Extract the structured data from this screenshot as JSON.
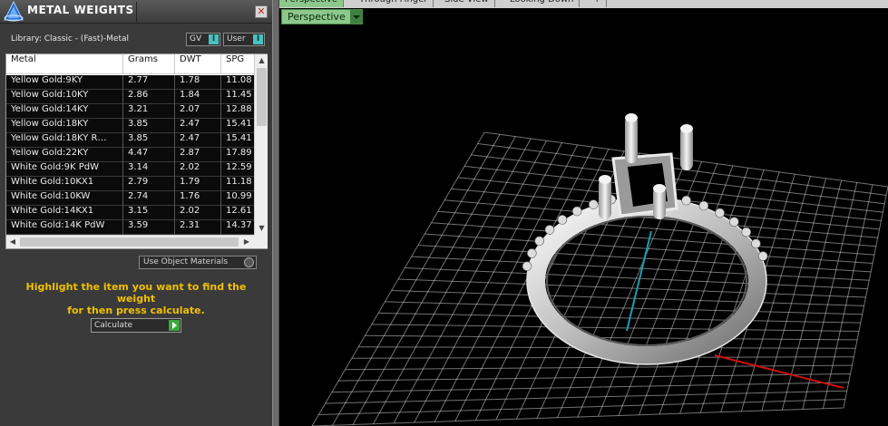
{
  "panel": {
    "title": "METAL WEIGHTS",
    "close_glyph": "✕",
    "library_label": "Library: Classic - (Fast)-Metal",
    "gv_label": "GV",
    "user_label": "User",
    "toggle_glyph": "I",
    "columns": [
      "Metal",
      "Grams",
      "DWT",
      "SPG"
    ],
    "rows": [
      {
        "metal": "Yellow Gold:9KY",
        "grams": "2.77",
        "dwt": "1.78",
        "spg": "11.08"
      },
      {
        "metal": "Yellow Gold:10KY",
        "grams": "2.86",
        "dwt": "1.84",
        "spg": "11.45"
      },
      {
        "metal": "Yellow Gold:14KY",
        "grams": "3.21",
        "dwt": "2.07",
        "spg": "12.88"
      },
      {
        "metal": "Yellow Gold:18KY",
        "grams": "3.85",
        "dwt": "2.47",
        "spg": "15.41"
      },
      {
        "metal": "Yellow Gold:18KY R…",
        "grams": "3.85",
        "dwt": "2.47",
        "spg": "15.41"
      },
      {
        "metal": "Yellow Gold:22KY",
        "grams": "4.47",
        "dwt": "2.87",
        "spg": "17.89"
      },
      {
        "metal": "White Gold:9K PdW",
        "grams": "3.14",
        "dwt": "2.02",
        "spg": "12.59"
      },
      {
        "metal": "White Gold:10KX1",
        "grams": "2.79",
        "dwt": "1.79",
        "spg": "11.18"
      },
      {
        "metal": "White Gold:10KW",
        "grams": "2.74",
        "dwt": "1.76",
        "spg": "10.99"
      },
      {
        "metal": "White Gold:14KX1",
        "grams": "3.15",
        "dwt": "2.02",
        "spg": "12.61"
      },
      {
        "metal": "White Gold:14K PdW",
        "grams": "3.59",
        "dwt": "2.31",
        "spg": "14.37"
      }
    ],
    "use_object_materials": "Use Object Materials",
    "help_line1": "Highlight the item you want to find the weight",
    "help_line2": "for then press calculate.",
    "calculate_label": "Calculate"
  },
  "viewport": {
    "tabs": [
      "Perspective",
      "Through Finger",
      "Side View",
      "Looking Down",
      "+"
    ],
    "view_selector": "Perspective"
  },
  "colors": {
    "accent_green": "#8cc88c",
    "help_text": "#f0c000",
    "toggle": "#4bc0c0",
    "grid": "#cfcfcf",
    "axis_x": "#d01010",
    "axis_z": "#18a0b0"
  }
}
